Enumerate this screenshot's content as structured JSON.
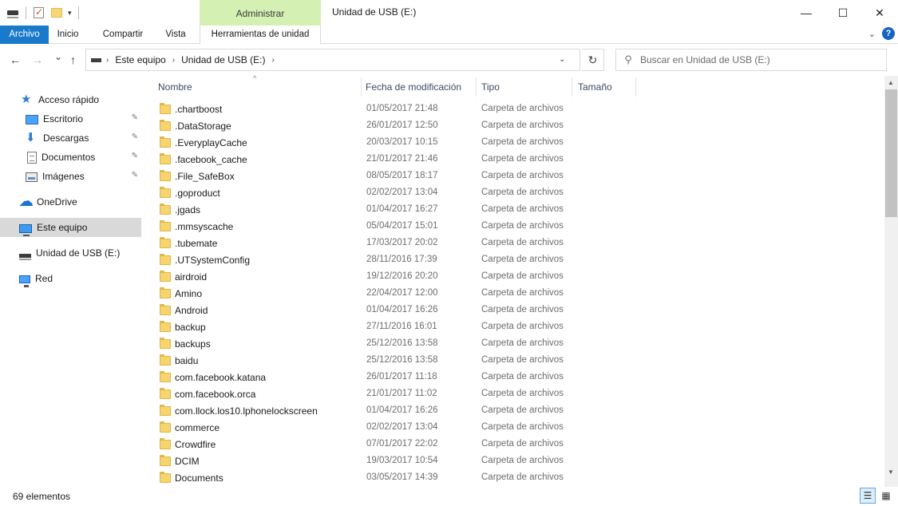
{
  "window": {
    "title": "Unidad de USB (E:)",
    "context_group": "Administrar",
    "minimize": "—",
    "maximize": "☐",
    "close": "✕"
  },
  "ribbon": {
    "tabs": [
      "Archivo",
      "Inicio",
      "Compartir",
      "Vista",
      "Herramientas de unidad"
    ],
    "help": "?"
  },
  "address": {
    "crumbs": [
      "Este equipo",
      "Unidad de USB (E:)"
    ],
    "search_placeholder": "Buscar en Unidad de USB (E:)"
  },
  "nav_pane": {
    "items": [
      {
        "label": "Acceso rápido",
        "icon": "star-icon",
        "pinned": false,
        "indent": false
      },
      {
        "label": "Escritorio",
        "icon": "desktop-icon",
        "pinned": true,
        "indent": true
      },
      {
        "label": "Descargas",
        "icon": "downloads-icon",
        "pinned": true,
        "indent": true
      },
      {
        "label": "Documentos",
        "icon": "documents-icon",
        "pinned": true,
        "indent": true
      },
      {
        "label": "Imágenes",
        "icon": "pictures-icon",
        "pinned": true,
        "indent": true
      },
      {
        "label": "OneDrive",
        "icon": "onedrive-icon",
        "pinned": false,
        "indent": false
      },
      {
        "label": "Este equipo",
        "icon": "this-pc-icon",
        "pinned": false,
        "indent": false,
        "selected": true
      },
      {
        "label": "Unidad de USB (E:)",
        "icon": "usb-drive-icon",
        "pinned": false,
        "indent": false
      },
      {
        "label": "Red",
        "icon": "network-icon",
        "pinned": false,
        "indent": false
      }
    ]
  },
  "columns": {
    "name": "Nombre",
    "date": "Fecha de modificación",
    "type": "Tipo",
    "size": "Tamaño"
  },
  "files": [
    {
      "name": ".chartboost",
      "date": "01/05/2017 21:48",
      "type": "Carpeta de archivos"
    },
    {
      "name": ".DataStorage",
      "date": "26/01/2017 12:50",
      "type": "Carpeta de archivos"
    },
    {
      "name": ".EveryplayCache",
      "date": "20/03/2017 10:15",
      "type": "Carpeta de archivos"
    },
    {
      "name": ".facebook_cache",
      "date": "21/01/2017 21:46",
      "type": "Carpeta de archivos"
    },
    {
      "name": ".File_SafeBox",
      "date": "08/05/2017 18:17",
      "type": "Carpeta de archivos"
    },
    {
      "name": ".goproduct",
      "date": "02/02/2017 13:04",
      "type": "Carpeta de archivos"
    },
    {
      "name": ".jgads",
      "date": "01/04/2017 16:27",
      "type": "Carpeta de archivos"
    },
    {
      "name": ".mmsyscache",
      "date": "05/04/2017 15:01",
      "type": "Carpeta de archivos"
    },
    {
      "name": ".tubemate",
      "date": "17/03/2017 20:02",
      "type": "Carpeta de archivos"
    },
    {
      "name": ".UTSystemConfig",
      "date": "28/11/2016 17:39",
      "type": "Carpeta de archivos"
    },
    {
      "name": "airdroid",
      "date": "19/12/2016 20:20",
      "type": "Carpeta de archivos"
    },
    {
      "name": "Amino",
      "date": "22/04/2017 12:00",
      "type": "Carpeta de archivos"
    },
    {
      "name": "Android",
      "date": "01/04/2017 16:26",
      "type": "Carpeta de archivos"
    },
    {
      "name": "backup",
      "date": "27/11/2016 16:01",
      "type": "Carpeta de archivos"
    },
    {
      "name": "backups",
      "date": "25/12/2016 13:58",
      "type": "Carpeta de archivos"
    },
    {
      "name": "baidu",
      "date": "25/12/2016 13:58",
      "type": "Carpeta de archivos"
    },
    {
      "name": "com.facebook.katana",
      "date": "26/01/2017 11:18",
      "type": "Carpeta de archivos"
    },
    {
      "name": "com.facebook.orca",
      "date": "21/01/2017 11:02",
      "type": "Carpeta de archivos"
    },
    {
      "name": "com.llock.los10.lphonelockscreen",
      "date": "01/04/2017 16:26",
      "type": "Carpeta de archivos"
    },
    {
      "name": "commerce",
      "date": "02/02/2017 13:04",
      "type": "Carpeta de archivos"
    },
    {
      "name": "Crowdfire",
      "date": "07/01/2017 22:02",
      "type": "Carpeta de archivos"
    },
    {
      "name": "DCIM",
      "date": "19/03/2017 10:54",
      "type": "Carpeta de archivos"
    },
    {
      "name": "Documents",
      "date": "03/05/2017 14:39",
      "type": "Carpeta de archivos"
    }
  ],
  "status": {
    "count": "69 elementos"
  },
  "icons": {
    "back": "←",
    "forward": "→",
    "recent": "⌄",
    "up": "↑",
    "refresh": "↻",
    "search": "⚲",
    "dropdown": "⌄",
    "crumb_sep": "›",
    "sort": "^",
    "pin": "📌"
  },
  "colors": {
    "file_tab": "#1979ca",
    "context_tab": "#d5f0b3",
    "selection": "#d9d9d9",
    "folder": "#f6d46f"
  }
}
